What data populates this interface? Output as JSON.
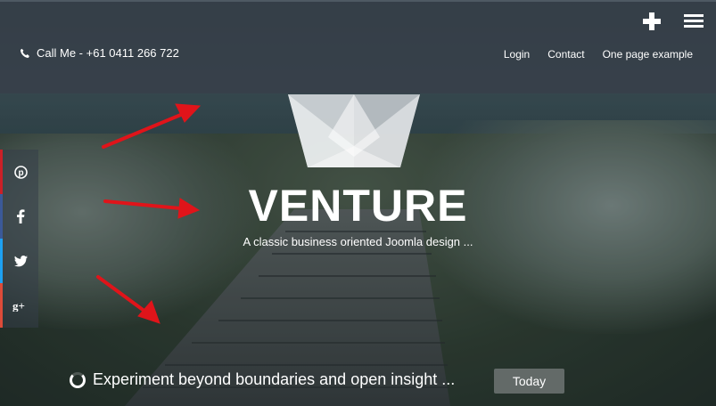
{
  "header": {
    "phone_label": "Call Me - +61 0411 266 722",
    "nav": [
      "Login",
      "Contact",
      "One page example"
    ]
  },
  "hero": {
    "brand": "VENTURE",
    "tagline": "A classic business oriented Joomla design ..."
  },
  "social": [
    "pinterest-icon",
    "facebook-icon",
    "twitter-icon",
    "google-plus-icon"
  ],
  "ticker": {
    "text": "Experiment beyond boundaries and open insight ...",
    "button": "Today"
  },
  "colors": {
    "pinterest": "#cb2027",
    "facebook": "#3b5998",
    "twitter": "#1da1f2",
    "google_plus": "#dd4b39",
    "arrow": "#e0141a"
  }
}
